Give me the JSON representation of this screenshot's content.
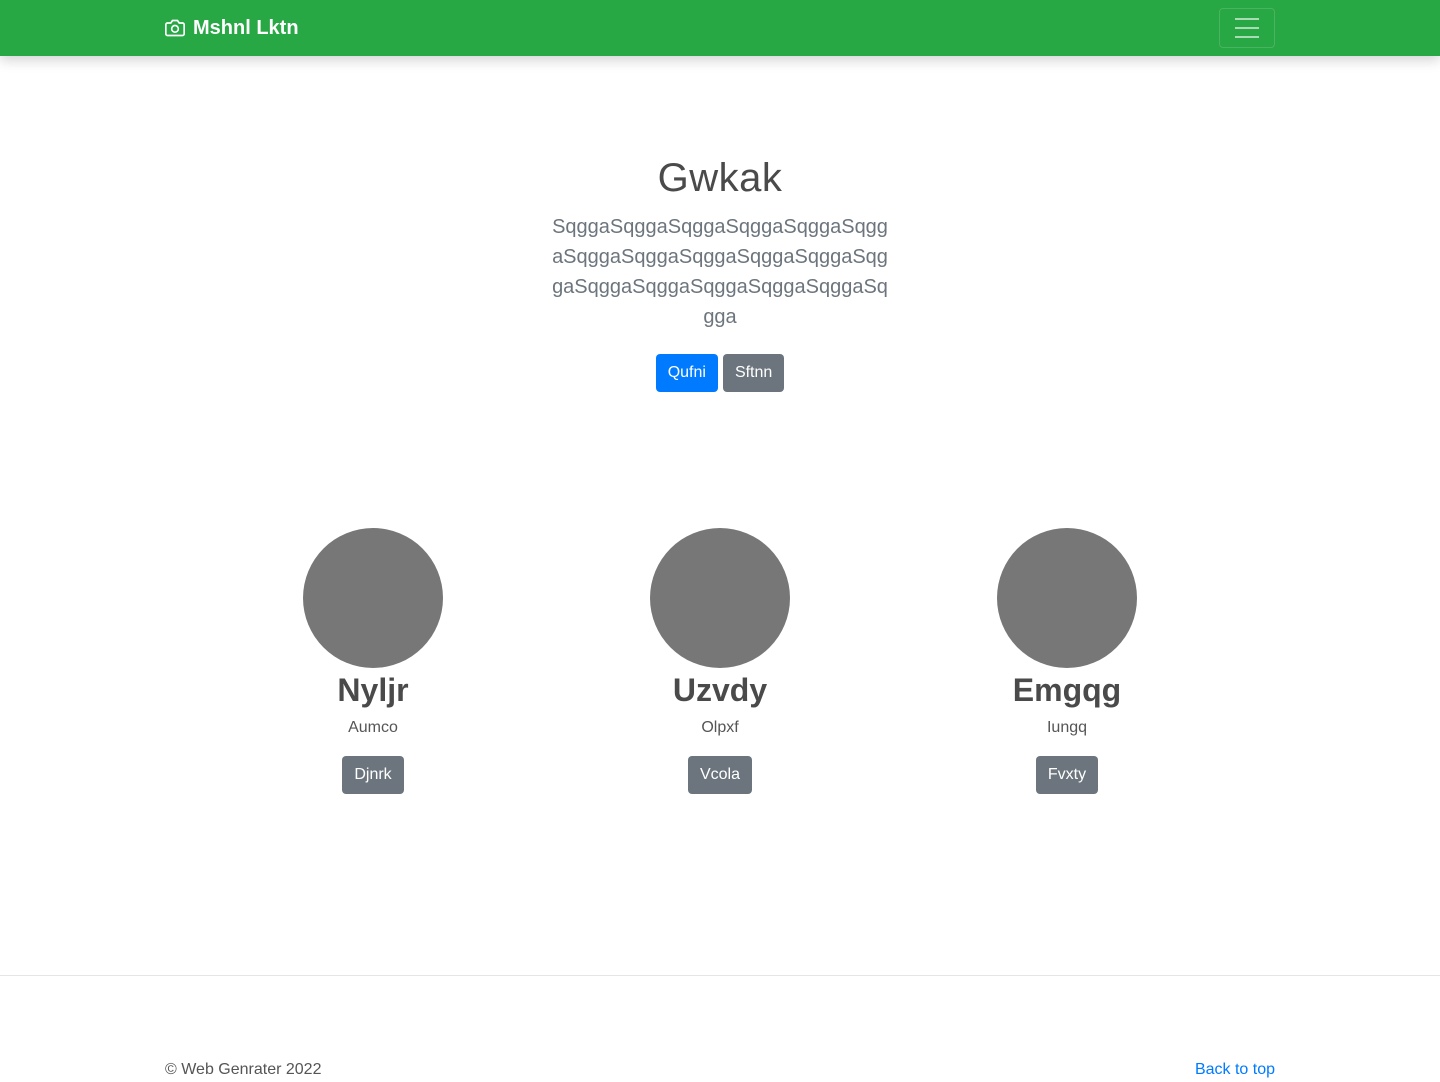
{
  "navbar": {
    "brand": "Mshnl Lktn",
    "brand_icon": "camera-icon",
    "toggler_icon": "hamburger-menu-icon",
    "color": "#28a745"
  },
  "hero": {
    "title": "Gwkak",
    "lead": "SqggaSqggaSqggaSqggaSqggaSqggaSqggaSqggaSqggaSqggaSqggaSqggaSqggaSqggaSqggaSqggaSqggaSqgga",
    "primary_button": "Qufni",
    "secondary_button": "Sftnn"
  },
  "team": [
    {
      "name": "Nyljr",
      "role": "Aumco",
      "button": "Djnrk"
    },
    {
      "name": "Uzvdy",
      "role": "Olpxf",
      "button": "Vcola"
    },
    {
      "name": "Emgqg",
      "role": "Iungq",
      "button": "Fvxty"
    }
  ],
  "footer": {
    "copyright": "© Web Genrater 2022",
    "back_to_top": "Back to top"
  },
  "colors": {
    "primary": "#007bff",
    "secondary": "#6c757d",
    "avatar": "#777777"
  }
}
